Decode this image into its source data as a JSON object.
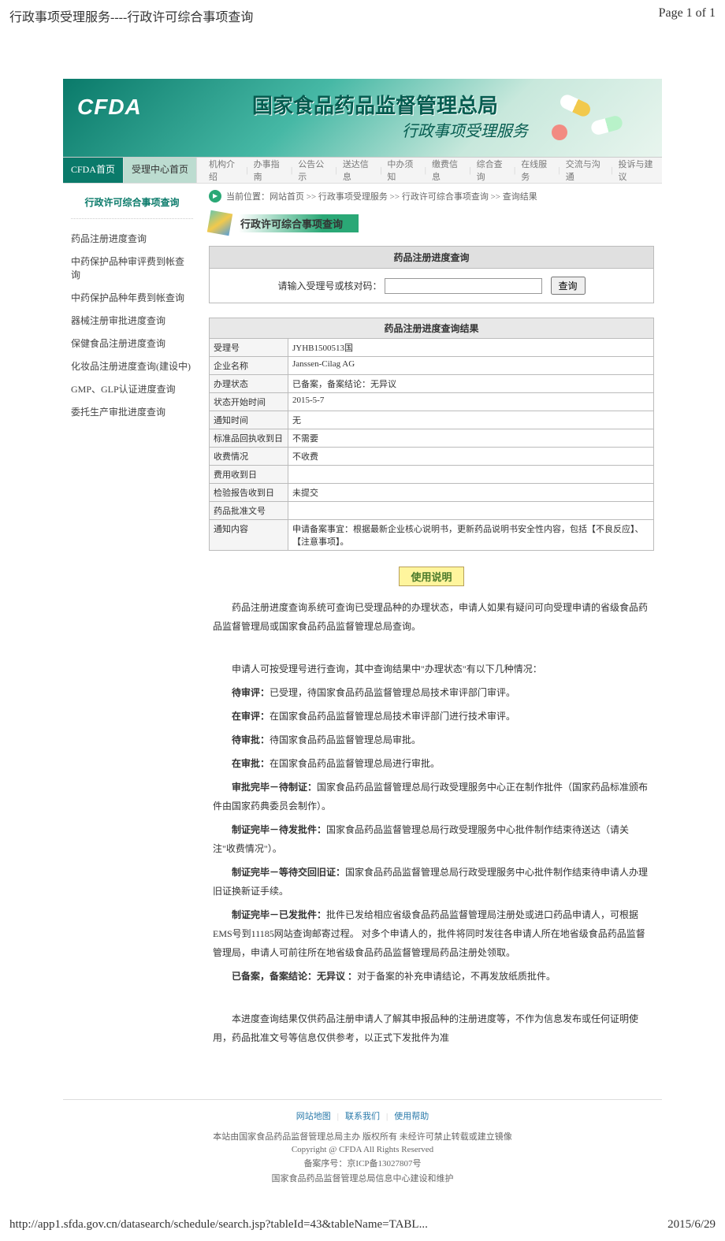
{
  "page": {
    "header_title": "行政事项受理服务----行政许可综合事项查询",
    "header_page": "Page 1 of 1",
    "footer_url": "http://app1.sfda.gov.cn/datasearch/schedule/search.jsp?tableId=43&tableName=TABL...",
    "footer_date": "2015/6/29"
  },
  "banner": {
    "logo": "CFDA",
    "title": "国家食品药品监督管理总局",
    "subtitle": "行政事项受理服务"
  },
  "nav": {
    "tab1": "CFDA首页",
    "tab2": "受理中心首页",
    "menu": [
      "机构介绍",
      "办事指南",
      "公告公示",
      "送达信息",
      "中办须知",
      "缴费信息",
      "综合查询",
      "在线服务",
      "交流与沟通",
      "投诉与建议"
    ]
  },
  "sidebar": {
    "title": "行政许可综合事项查询",
    "items": [
      "药品注册进度查询",
      "中药保护品种审评费到帐查询",
      "中药保护品种年费到帐查询",
      "器械注册审批进度查询",
      "保健食品注册进度查询",
      "化妆品注册进度查询(建设中)",
      "GMP、GLP认证进度查询",
      "委托生产审批进度查询"
    ]
  },
  "breadcrumb": {
    "prefix": "当前位置：",
    "parts": [
      "网站首页",
      "行政事项受理服务",
      "行政许可综合事项查询",
      "查询结果"
    ]
  },
  "section_title": "行政许可综合事项查询",
  "search": {
    "header": "药品注册进度查询",
    "label": "请输入受理号或核对码：",
    "placeholder": "",
    "button": "查询"
  },
  "result": {
    "caption": "药品注册进度查询结果",
    "rows": [
      {
        "label": "受理号",
        "value": "JYHB1500513国"
      },
      {
        "label": "企业名称",
        "value": "Janssen-Cilag AG"
      },
      {
        "label": "办理状态",
        "value": "已备案，备案结论：无异议"
      },
      {
        "label": "状态开始时间",
        "value": "2015-5-7"
      },
      {
        "label": "通知时间",
        "value": "无"
      },
      {
        "label": "标准品回执收到日",
        "value": "不需要"
      },
      {
        "label": "收费情况",
        "value": "不收费"
      },
      {
        "label": "费用收到日",
        "value": ""
      },
      {
        "label": "检验报告收到日",
        "value": "未提交"
      },
      {
        "label": "药品批准文号",
        "value": ""
      },
      {
        "label": "通知内容",
        "value": "申请备案事宜：根据最新企业核心说明书，更新药品说明书安全性内容，包括【不良反应】、【注意事项】。"
      }
    ]
  },
  "usage": {
    "title": "使用说明",
    "intro": "药品注册进度查询系统可查询已受理品种的办理状态，申请人如果有疑问可向受理申请的省级食品药品监督管理局或国家食品药品监督管理总局查询。",
    "line_lead": "申请人可按受理号进行查询，其中查询结果中\"办理状态\"有以下几种情况：",
    "statuses": [
      {
        "name": "待审评：",
        "desc": "已受理，待国家食品药品监督管理总局技术审评部门审评。"
      },
      {
        "name": "在审评：",
        "desc": "在国家食品药品监督管理总局技术审评部门进行技术审评。"
      },
      {
        "name": "待审批：",
        "desc": "待国家食品药品监督管理总局审批。"
      },
      {
        "name": "在审批：",
        "desc": "在国家食品药品监督管理总局进行审批。"
      },
      {
        "name": "审批完毕－待制证：",
        "desc": "国家食品药品监督管理总局行政受理服务中心正在制作批件（国家药品标准颁布件由国家药典委员会制作）。"
      },
      {
        "name": "制证完毕－待发批件：",
        "desc": "国家食品药品监督管理总局行政受理服务中心批件制作结束待送达（请关注\"收费情况\"）。"
      },
      {
        "name": "制证完毕－等待交回旧证：",
        "desc": "国家食品药品监督管理总局行政受理服务中心批件制作结束待申请人办理旧证换新证手续。"
      },
      {
        "name": "制证完毕－已发批件：",
        "desc": "批件已发给相应省级食品药品监督管理局注册处或进口药品申请人，可根据EMS号到11185网站查询邮寄过程。 对多个申请人的，批件将同时发往各申请人所在地省级食品药品监督管理局，申请人可前往所在地省级食品药品监督管理局药品注册处领取。"
      },
      {
        "name": "已备案，备案结论：无异议 ：",
        "desc": "对于备案的补充申请结论，不再发放纸质批件。"
      }
    ],
    "note": "本进度查询结果仅供药品注册申请人了解其申报品种的注册进度等，不作为信息发布或任何证明使用，药品批准文号等信息仅供参考，以正式下发批件为准"
  },
  "footer": {
    "links": [
      "网站地图",
      "联系我们",
      "使用帮助"
    ],
    "lines": [
      "本站由国家食品药品监督管理总局主办  版权所有  未经许可禁止转载或建立镜像",
      "Copyright @ CFDA All Rights Reserved",
      "备案序号：京ICP备13027807号",
      "国家食品药品监督管理总局信息中心建设和维护"
    ]
  }
}
